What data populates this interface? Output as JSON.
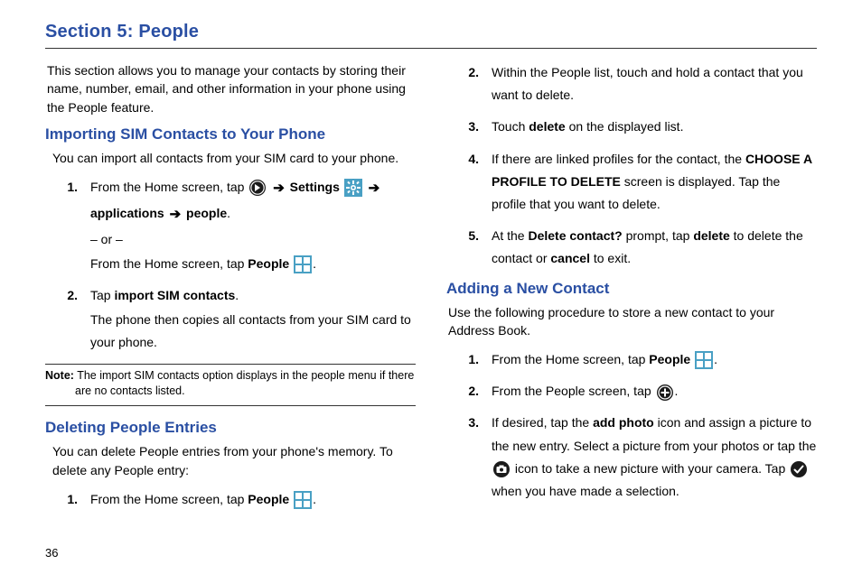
{
  "page_number": "36",
  "section_title": "Section 5: People",
  "intro": "This section allows you to manage your contacts by storing their name, number, email, and other information in your phone using the People feature.",
  "import": {
    "title": "Importing SIM Contacts to Your Phone",
    "lead": "You can import all contacts from your SIM card to your phone.",
    "step1_a": "From the Home screen, tap ",
    "settings_label": "Settings",
    "step1_b": "applications",
    "step1_people": "people",
    "step1_or": "– or –",
    "step1_alt_a": "From the Home screen, tap ",
    "people_label": "People",
    "step2_a": "Tap ",
    "step2_bold": "import SIM contacts",
    "step2_b": ".",
    "step2_extra": "The phone then copies all contacts from your SIM card to your phone.",
    "note_label": "Note:",
    "note_text": "The import SIM contacts option displays in the people menu if there are no contacts listed."
  },
  "delete": {
    "title": "Deleting People Entries",
    "lead": "You can delete People entries from your phone's memory. To delete any People entry:",
    "step1_a": "From the Home screen, tap ",
    "people_label": "People",
    "step2": "Within the People list, touch and hold a contact that you want to delete.",
    "step3_a": "Touch ",
    "step3_bold": "delete",
    "step3_b": " on the displayed list.",
    "step4_a": "If there are linked profiles for the contact, the ",
    "step4_bold": "CHOOSE A PROFILE TO DELETE",
    "step4_b": " screen is displayed. Tap the profile that you want to delete.",
    "step5_a": "At the ",
    "step5_bold1": "Delete contact?",
    "step5_mid1": " prompt, tap ",
    "step5_bold2": "delete",
    "step5_mid2": " to delete the contact or ",
    "step5_bold3": "cancel",
    "step5_end": " to exit."
  },
  "add": {
    "title": "Adding a New Contact",
    "lead": "Use the following procedure to store a new contact to your Address Book.",
    "step1_a": "From the Home screen, tap ",
    "people_label": "People",
    "step2_a": "From the People screen, tap ",
    "step3_a": "If desired, tap the ",
    "step3_bold": "add photo",
    "step3_b": " icon and assign a picture to the new entry. Select a picture from your photos or tap the ",
    "step3_c": " icon to take a new picture with your camera. Tap ",
    "step3_d": " when you have made a selection."
  }
}
